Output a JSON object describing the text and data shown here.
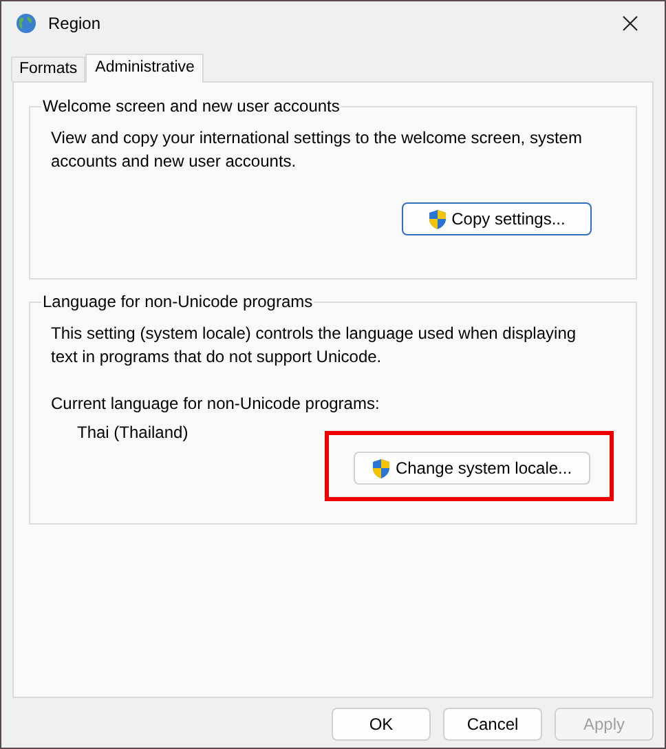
{
  "window": {
    "title": "Region"
  },
  "tabs": [
    {
      "label": "Formats",
      "selected": false
    },
    {
      "label": "Administrative",
      "selected": true
    }
  ],
  "groups": [
    {
      "title": "Welcome screen and new user accounts",
      "description": "View and copy your international settings to the welcome screen, system accounts and new user accounts.",
      "button": {
        "label": "Copy settings...",
        "highlighted": false
      }
    },
    {
      "title": "Language for non-Unicode programs",
      "description": "This setting (system locale) controls the language used when displaying text in programs that do not support Unicode.",
      "current_label": "Current language for non-Unicode programs:",
      "current_value": "Thai (Thailand)",
      "button": {
        "label": "Change system locale...",
        "highlighted": true
      }
    }
  ],
  "buttons": [
    {
      "label": "OK",
      "disabled": false
    },
    {
      "label": "Cancel",
      "disabled": false
    },
    {
      "label": "Apply",
      "disabled": true
    }
  ]
}
